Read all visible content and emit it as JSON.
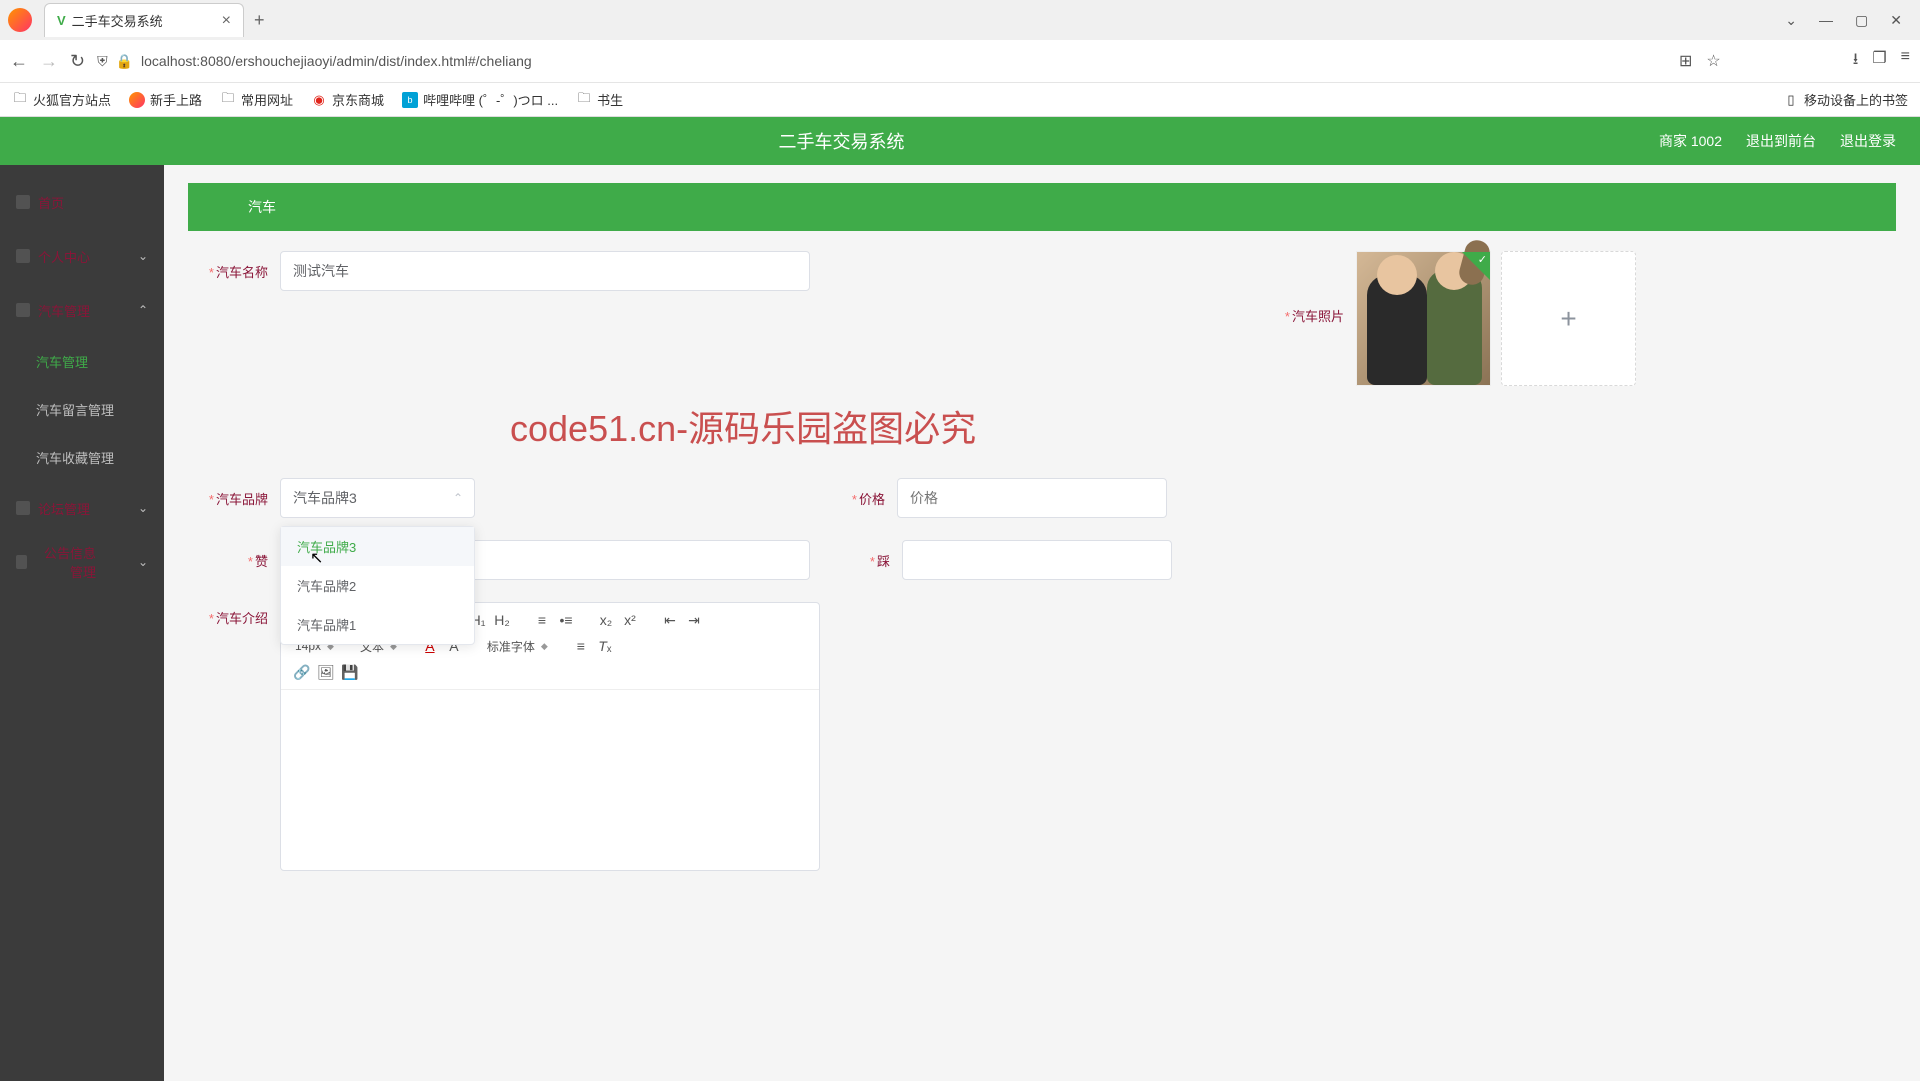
{
  "browser": {
    "tab_title": "二手车交易系统",
    "url": "localhost:8080/ershouchejiaoyi/admin/dist/index.html#/cheliang",
    "bookmarks": {
      "b1": "火狐官方站点",
      "b2": "新手上路",
      "b3": "常用网址",
      "b4": "京东商城",
      "b5": "哔哩哔哩 (゜-゜)つロ ...",
      "b6": "书生",
      "right": "移动设备上的书签"
    }
  },
  "header": {
    "title": "二手车交易系统",
    "merchant": "商家 1002",
    "exit_front": "退出到前台",
    "logout": "退出登录"
  },
  "sidebar": {
    "home": "首页",
    "personal": "个人中心",
    "car_mgmt": "汽车管理",
    "sub_car": "汽车管理",
    "sub_msg": "汽车留言管理",
    "sub_fav": "汽车收藏管理",
    "forum": "论坛管理",
    "notice": "公告信息管理"
  },
  "content": {
    "header_tab": "汽车"
  },
  "form": {
    "name_label": "汽车名称",
    "name_value": "测试汽车",
    "photo_label": "汽车照片",
    "brand_label": "汽车品牌",
    "brand_value": "汽车品牌3",
    "brand_opts": {
      "o1": "汽车品牌3",
      "o2": "汽车品牌2",
      "o3": "汽车品牌1"
    },
    "price_label": "价格",
    "price_placeholder": "价格",
    "like_label": "赞",
    "dislike_label": "踩",
    "intro_label": "汽车介绍"
  },
  "editor": {
    "fontsize": "14px",
    "texttype": "文本",
    "fontfamily": "标准字体"
  },
  "watermark": "code51.cn-源码乐园盗图必究"
}
